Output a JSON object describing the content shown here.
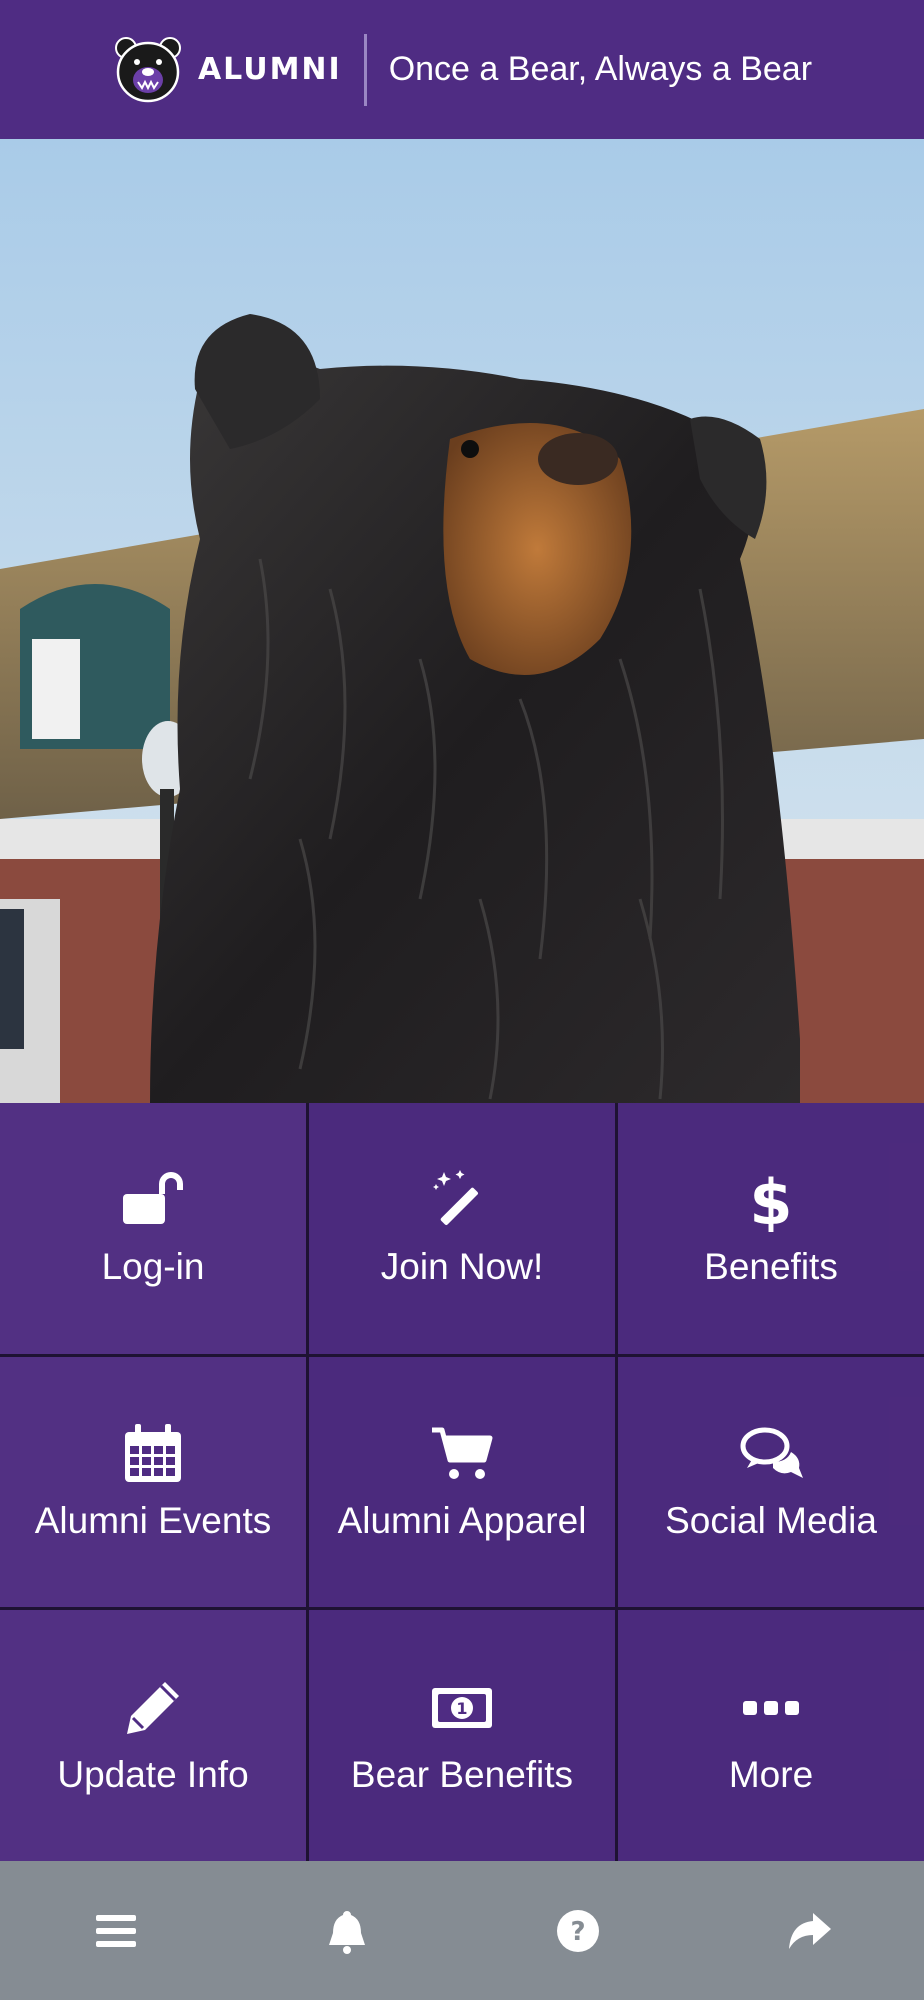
{
  "header": {
    "brand": "ALUMNI",
    "tagline": "Once a Bear, Always a Bear"
  },
  "colors": {
    "primary": "#4f2c83",
    "tile": "#4f2c83",
    "bottom_bar": "#858c93",
    "icon": "#ffffff"
  },
  "hero": {
    "subject": "bear-statue-photo"
  },
  "grid": {
    "items": [
      {
        "label": "Log-in",
        "icon": "unlock-icon"
      },
      {
        "label": "Join Now!",
        "icon": "magic-wand-icon"
      },
      {
        "label": "Benefits",
        "icon": "dollar-icon"
      },
      {
        "label": "Alumni Events",
        "icon": "calendar-icon"
      },
      {
        "label": "Alumni Apparel",
        "icon": "cart-icon"
      },
      {
        "label": "Social Media",
        "icon": "chat-bubbles-icon"
      },
      {
        "label": "Update Info",
        "icon": "pencil-icon"
      },
      {
        "label": "Bear Benefits",
        "icon": "banknote-icon"
      },
      {
        "label": "More",
        "icon": "ellipsis-icon"
      }
    ]
  },
  "bottom_nav": {
    "items": [
      {
        "icon": "menu-icon"
      },
      {
        "icon": "bell-icon"
      },
      {
        "icon": "help-icon"
      },
      {
        "icon": "share-icon"
      }
    ]
  }
}
